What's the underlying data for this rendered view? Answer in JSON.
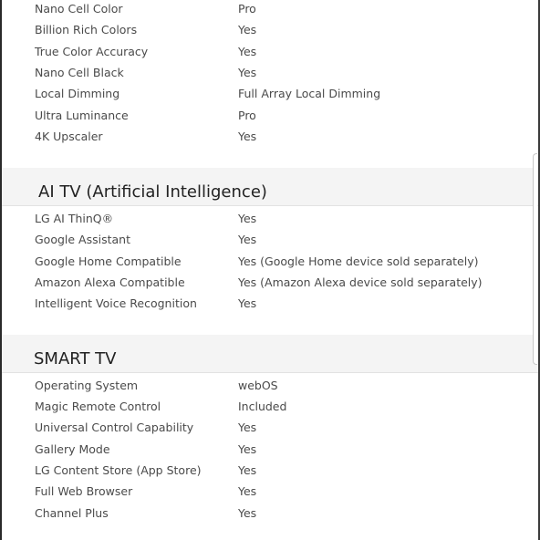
{
  "sections": [
    {
      "title": "",
      "rows": [
        {
          "label": "Nano Cell Color",
          "value": "Pro"
        },
        {
          "label": "Billion Rich Colors",
          "value": "Yes"
        },
        {
          "label": "True Color Accuracy",
          "value": "Yes"
        },
        {
          "label": "Nano Cell Black",
          "value": "Yes"
        },
        {
          "label": "Local Dimming",
          "value": "Full Array Local Dimming"
        },
        {
          "label": "Ultra Luminance",
          "value": "Pro"
        },
        {
          "label": "4K Upscaler",
          "value": "Yes"
        }
      ]
    },
    {
      "title": "AI TV (Artificial Intelligence)",
      "rows": [
        {
          "label": "LG AI ThinQ®",
          "value": "Yes"
        },
        {
          "label": "Google Assistant",
          "value": "Yes"
        },
        {
          "label": "Google Home Compatible",
          "value": "Yes (Google Home device sold separately)"
        },
        {
          "label": "Amazon Alexa Compatible",
          "value": "Yes (Amazon Alexa device sold separately)"
        },
        {
          "label": "Intelligent Voice Recognition",
          "value": "Yes"
        }
      ]
    },
    {
      "title": "SMART TV",
      "rows": [
        {
          "label": "Operating System",
          "value": "webOS"
        },
        {
          "label": "Magic Remote Control",
          "value": "Included"
        },
        {
          "label": "Universal Control Capability",
          "value": "Yes"
        },
        {
          "label": "Gallery Mode",
          "value": "Yes"
        },
        {
          "label": "LG Content Store (App Store)",
          "value": "Yes"
        },
        {
          "label": "Full Web Browser",
          "value": "Yes"
        },
        {
          "label": "Channel Plus",
          "value": "Yes"
        }
      ]
    }
  ]
}
